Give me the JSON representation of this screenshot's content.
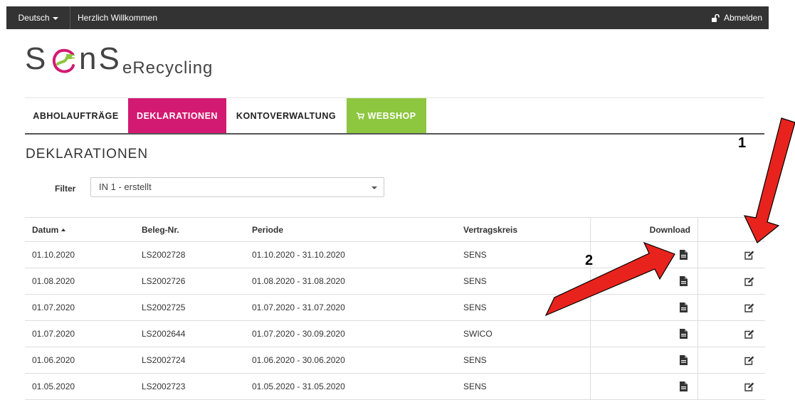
{
  "topbar": {
    "language": "Deutsch",
    "welcome": "Herzlich Willkommen",
    "logout": "Abmelden"
  },
  "logo": {
    "brand_left": "S",
    "brand_right": "nS",
    "product": "eRecycling"
  },
  "nav": {
    "items": [
      {
        "label": "ABHOLAUFTRÄGE"
      },
      {
        "label": "DEKLARATIONEN"
      },
      {
        "label": "KONTOVERWALTUNG"
      },
      {
        "label": "WEBSHOP"
      }
    ]
  },
  "page": {
    "title": "DEKLARATIONEN",
    "filter_label": "Filter",
    "filter_value": "IN 1 - erstellt"
  },
  "table": {
    "columns": [
      "Datum",
      "Beleg-Nr.",
      "Periode",
      "Vertragskreis",
      "Download",
      ""
    ],
    "rows": [
      {
        "datum": "01.10.2020",
        "beleg": "LS2002728",
        "periode": "01.10.2020 - 31.10.2020",
        "vertragskreis": "SENS"
      },
      {
        "datum": "01.08.2020",
        "beleg": "LS2002726",
        "periode": "01.08.2020 - 31.08.2020",
        "vertragskreis": "SENS"
      },
      {
        "datum": "01.07.2020",
        "beleg": "LS2002725",
        "periode": "01.07.2020 - 31.07.2020",
        "vertragskreis": "SENS"
      },
      {
        "datum": "01.07.2020",
        "beleg": "LS2002644",
        "periode": "01.07.2020 - 30.09.2020",
        "vertragskreis": "SWICO"
      },
      {
        "datum": "01.06.2020",
        "beleg": "LS2002724",
        "periode": "01.06.2020 - 30.06.2020",
        "vertragskreis": "SENS"
      },
      {
        "datum": "01.05.2020",
        "beleg": "LS2002723",
        "periode": "01.05.2020 - 31.05.2020",
        "vertragskreis": "SENS"
      }
    ]
  },
  "annotations": {
    "marker_1": "1",
    "marker_2": "2"
  },
  "colors": {
    "topbar": "#333333",
    "nav_active": "#d31a72",
    "nav_shop": "#8dc63f",
    "logo_plug": "#d31a72",
    "arrow": "#e8231d"
  },
  "icons": {
    "logout": "unlock-icon",
    "webshop": "cart-icon",
    "download": "file-icon",
    "edit": "edit-icon"
  }
}
